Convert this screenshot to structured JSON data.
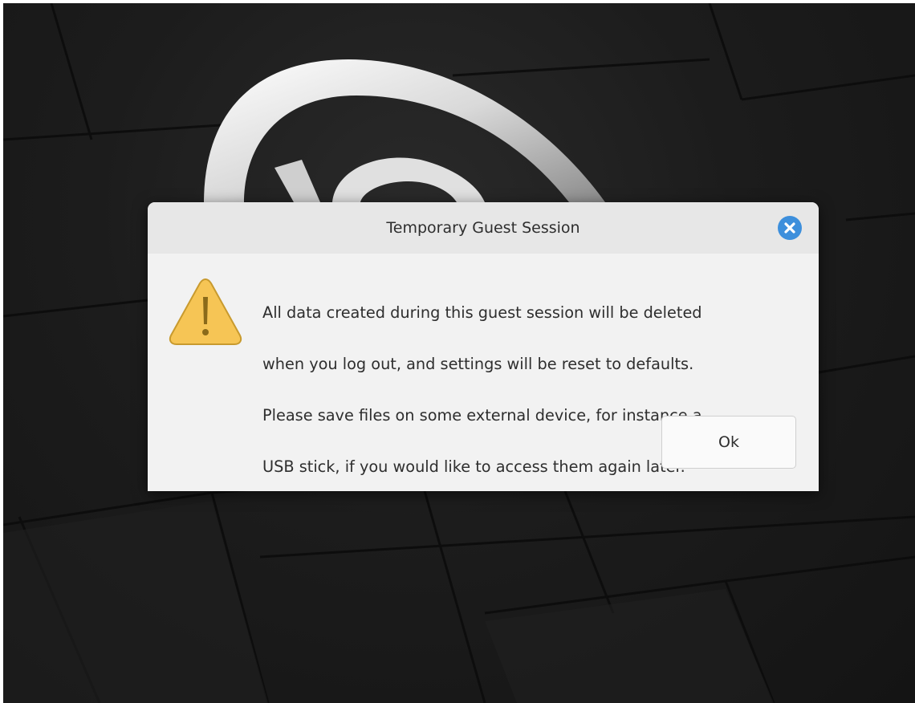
{
  "dialog": {
    "title": "Temporary Guest Session",
    "message_lines": [
      "All data created during this guest session will be deleted",
      "when you log out, and settings will be reset to defaults.",
      "Please save files on some external device, for instance a",
      "USB stick, if you would like to access them again later."
    ],
    "ok_label": "Ok",
    "close_icon": "close-icon",
    "warning_icon": "warning-triangle-icon"
  },
  "colors": {
    "close_button": "#3d8fdc",
    "warning_fill": "#f6c555",
    "dialog_background": "#f2f2f2",
    "titlebar_background": "#e7e7e7",
    "desktop_background": "#1c1c1c"
  }
}
